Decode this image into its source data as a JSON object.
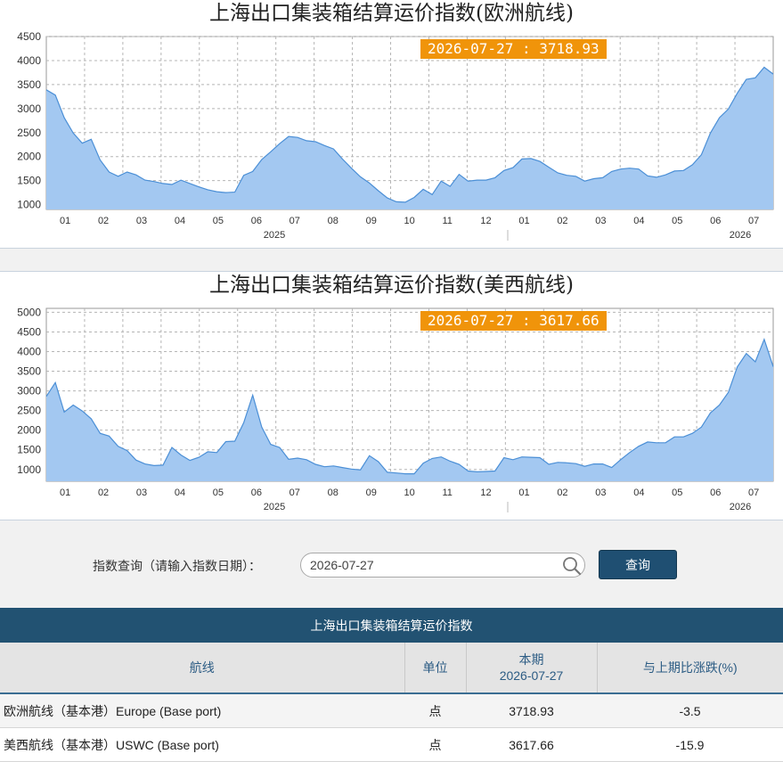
{
  "chart_data": [
    {
      "type": "area",
      "title": "上海出口集装箱结算运价指数(欧洲航线)",
      "ylim": [
        900,
        4500
      ],
      "yticks": [
        1000,
        1500,
        2000,
        2500,
        3000,
        3500,
        4000,
        4500
      ],
      "x_month_labels": [
        "01",
        "02",
        "03",
        "04",
        "05",
        "06",
        "07",
        "08",
        "09",
        "10",
        "11",
        "12",
        "01",
        "02",
        "03",
        "04",
        "05",
        "06",
        "07"
      ],
      "year_labels": [
        "2025",
        "2026"
      ],
      "tooltip": "2026-07-27 : 3718.93",
      "grid": true,
      "color": "#a3c8f1",
      "series": [
        {
          "values": [
            3390,
            3280,
            2810,
            2490,
            2280,
            2360,
            1930,
            1680,
            1590,
            1680,
            1620,
            1510,
            1480,
            1440,
            1420,
            1510,
            1440,
            1370,
            1310,
            1270,
            1250,
            1260,
            1610,
            1690,
            1940,
            2100,
            2270,
            2420,
            2400,
            2330,
            2310,
            2230,
            2160,
            1950,
            1760,
            1580,
            1450,
            1290,
            1140,
            1060,
            1050,
            1150,
            1320,
            1210,
            1490,
            1380,
            1630,
            1490,
            1510,
            1510,
            1560,
            1710,
            1770,
            1950,
            1960,
            1900,
            1780,
            1660,
            1610,
            1590,
            1490,
            1540,
            1560,
            1690,
            1740,
            1760,
            1740,
            1600,
            1570,
            1620,
            1700,
            1710,
            1830,
            2040,
            2490,
            2810,
            2990,
            3320,
            3610,
            3640,
            3860,
            3718.93
          ]
        }
      ]
    },
    {
      "type": "area",
      "title": "上海出口集装箱结算运价指数(美西航线)",
      "ylim": [
        700,
        5100
      ],
      "yticks": [
        1000,
        1500,
        2000,
        2500,
        3000,
        3500,
        4000,
        4500,
        5000
      ],
      "x_month_labels": [
        "01",
        "02",
        "03",
        "04",
        "05",
        "06",
        "07",
        "08",
        "09",
        "10",
        "11",
        "12",
        "01",
        "02",
        "03",
        "04",
        "05",
        "06",
        "07"
      ],
      "year_labels": [
        "2025",
        "2026"
      ],
      "tooltip": "2026-07-27 : 3617.66",
      "grid": true,
      "color": "#a3c8f1",
      "series": [
        {
          "values": [
            2860,
            3210,
            2460,
            2640,
            2490,
            2290,
            1920,
            1850,
            1590,
            1480,
            1240,
            1140,
            1100,
            1110,
            1560,
            1370,
            1230,
            1310,
            1450,
            1430,
            1710,
            1720,
            2190,
            2890,
            2080,
            1640,
            1560,
            1260,
            1290,
            1250,
            1130,
            1070,
            1090,
            1050,
            1010,
            990,
            1350,
            1200,
            930,
            910,
            890,
            890,
            1160,
            1280,
            1320,
            1210,
            1130,
            960,
            940,
            950,
            960,
            1300,
            1250,
            1320,
            1310,
            1300,
            1130,
            1180,
            1170,
            1150,
            1080,
            1140,
            1140,
            1050,
            1250,
            1430,
            1590,
            1700,
            1680,
            1680,
            1830,
            1830,
            1920,
            2080,
            2440,
            2640,
            2960,
            3610,
            3950,
            3740,
            4310,
            3617.66
          ]
        }
      ]
    }
  ],
  "search": {
    "label": "指数查询（请输入指数日期）：",
    "input_value": "2026-07-27",
    "button_label": "查询"
  },
  "table": {
    "caption": "上海出口集装箱结算运价指数",
    "headers": {
      "route": "航线",
      "unit": "单位",
      "current_line1": "本期",
      "current_line2": "2026-07-27",
      "change": "与上期比涨跌(%)"
    },
    "rows": [
      {
        "route": "欧洲航线（基本港）Europe (Base port)",
        "unit": "点",
        "value": "3718.93",
        "change": "-3.5"
      },
      {
        "route": "美西航线（基本港）USWC (Base port)",
        "unit": "点",
        "value": "3617.66",
        "change": "-15.9"
      }
    ]
  }
}
